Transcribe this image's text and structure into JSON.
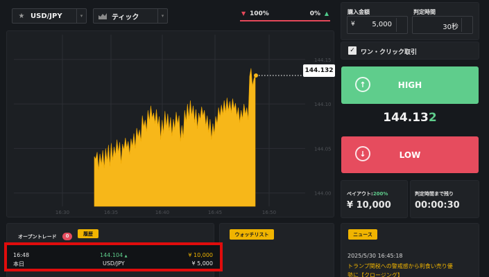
{
  "toolbar": {
    "pair": "USD/JPY",
    "chart_type": "ティック",
    "ratio_left": "100%",
    "ratio_right": "0%"
  },
  "chart": {
    "current_price": "144.132",
    "y_ticks": [
      "144.15",
      "144.10",
      "144.05",
      "144.00"
    ],
    "x_ticks": [
      "16:30",
      "16:35",
      "16:40",
      "16:45",
      "16:50"
    ],
    "fill_color": "#f7b719",
    "price_series": [
      144.041,
      144.038,
      144.046,
      144.026,
      144.044,
      144.032,
      144.048,
      144.028,
      144.05,
      144.035,
      144.054,
      144.03,
      144.056,
      144.037,
      144.052,
      144.042,
      144.06,
      144.045,
      144.057,
      144.033,
      144.055,
      144.048,
      144.062,
      144.05,
      144.058,
      144.043,
      144.061,
      144.052,
      144.067,
      144.05,
      144.073,
      144.062,
      144.071,
      144.058,
      144.087,
      144.074,
      144.082,
      144.069,
      144.093,
      144.08,
      144.098,
      144.084,
      144.09,
      144.078,
      144.094,
      144.075,
      144.086,
      144.06,
      144.082,
      144.067,
      144.092,
      144.073,
      144.089,
      144.07,
      144.085,
      144.064,
      144.083,
      144.071,
      144.091,
      144.077,
      144.087,
      144.058,
      144.076,
      144.062,
      144.093,
      144.08,
      144.1,
      144.083,
      144.104,
      144.086,
      144.098,
      144.079,
      144.094,
      144.072,
      144.09,
      144.082,
      144.097,
      144.086,
      144.093,
      144.075,
      144.087,
      144.068,
      144.083,
      144.06,
      144.078,
      144.066,
      144.086,
      144.077,
      144.096,
      144.085,
      144.099,
      144.088,
      144.104,
      144.09,
      144.107,
      144.092,
      144.103,
      144.09,
      144.106,
      144.094,
      144.101,
      144.086,
      144.096,
      144.079,
      144.093,
      144.083,
      144.1,
      144.088,
      144.096,
      144.082,
      144.131,
      144.14,
      144.12,
      144.128,
      144.132
    ]
  },
  "right": {
    "amount_label": "購入金額",
    "amount_currency": "¥",
    "amount_value": "5,000",
    "time_label": "判定時間",
    "time_value": "30秒",
    "one_click_label": "ワン・クリック取引",
    "high_label": "HIGH",
    "price_main": "144.13",
    "price_last": "2",
    "low_label": "LOW",
    "payout_label": "ペイアウト:",
    "payout_pct": "200%",
    "payout_value": "¥ 10,000",
    "remaining_label": "判定時間まで残り",
    "remaining_value": "00:00:30"
  },
  "bottom": {
    "open_trades_label": "オープントレード",
    "open_trades_count": "0",
    "history_label": "履歴",
    "watchlist_label": "ウォッチリスト",
    "news_label": "ニュース",
    "trade": {
      "time": "16:48",
      "day": "本日",
      "price": "144.104",
      "pair": "USD/JPY",
      "payout": "¥ 10,000",
      "amount": "¥ 5,000"
    },
    "news_time": "2025/5/30 16:45:18",
    "news_line1": "トランプ関税への警戒感から利食い売り優",
    "news_line2": "勢に【クロージング】"
  }
}
